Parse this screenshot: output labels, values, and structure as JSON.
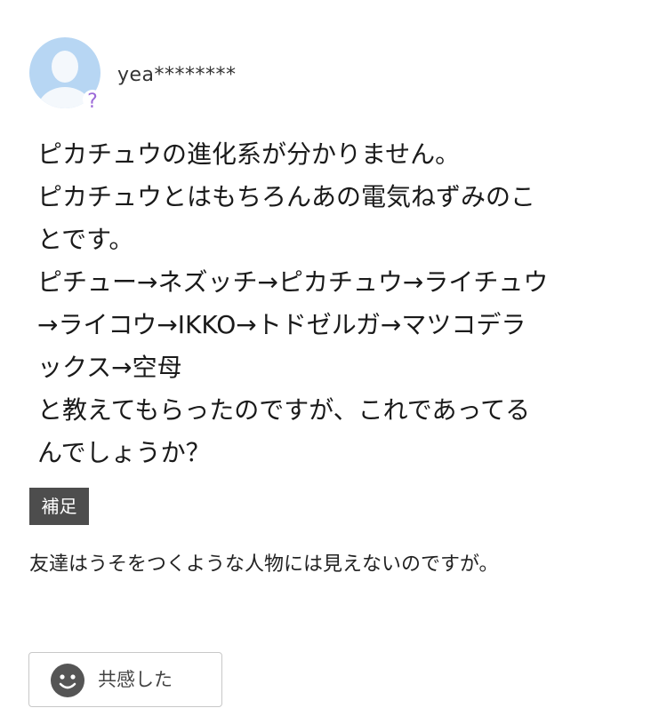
{
  "user": {
    "name": "yea********",
    "avatar_badge": "?",
    "icon": "default-user-avatar"
  },
  "question": {
    "lines": [
      "ピカチュウの進化系が分かりません。",
      "ピカチュウとはもちろんあの電気ねずみのこ",
      "とです。",
      "ピチュー→ネズッチ→ピカチュウ→ライチュウ",
      "→ライコウ→IKKO→トドゼルガ→マツコデラ",
      "ックス→空母",
      "と教えてもらったのですが、これであってる",
      "んでしょうか？"
    ]
  },
  "supplement": {
    "label": "補足",
    "text": "友達はうそをつくような人物には見えないのですが。"
  },
  "empathy_button": {
    "label": "共感した",
    "icon": "smile-icon"
  },
  "colors": {
    "avatar_bg": "#b7d6f3",
    "avatar_figure": "#f4f8fc",
    "badge_accent": "#9c6ad8",
    "supplement_bg": "#4d4d4d",
    "button_border": "#c8c8c8",
    "smile_icon": "#555555"
  }
}
